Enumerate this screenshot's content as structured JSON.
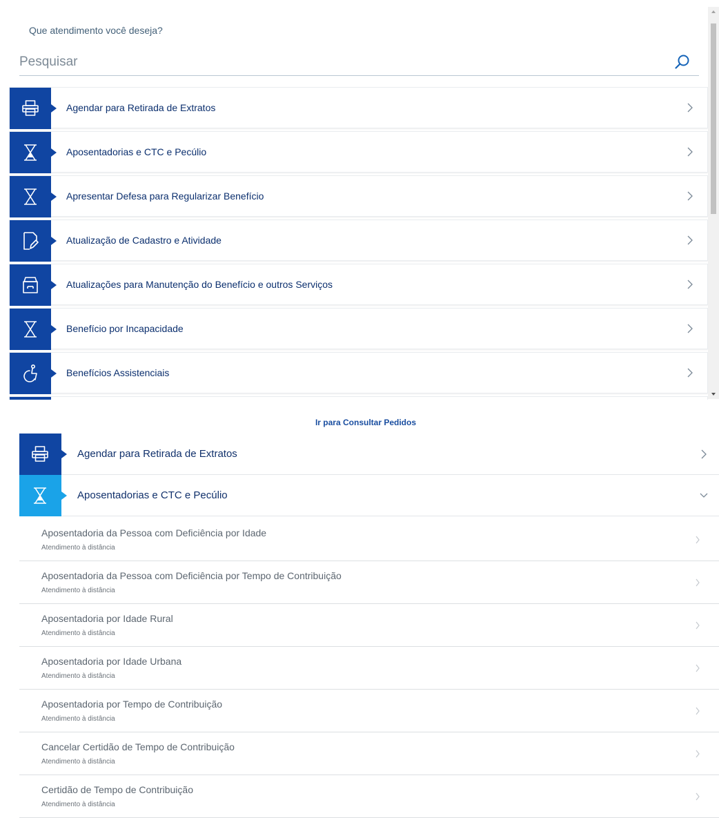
{
  "search": {
    "prompt": "Que atendimento você deseja?",
    "placeholder": "Pesquisar"
  },
  "categories": [
    {
      "label": "Agendar para Retirada de Extratos",
      "icon": "printer-icon"
    },
    {
      "label": "Aposentadorias e CTC e Pecúlio",
      "icon": "hourglass-icon"
    },
    {
      "label": "Apresentar Defesa para Regularizar Benefício",
      "icon": "hourglass-icon"
    },
    {
      "label": "Atualização de Cadastro e Atividade",
      "icon": "document-edit-icon"
    },
    {
      "label": "Atualizações para Manutenção do Benefício e outros Serviços",
      "icon": "archive-box-icon"
    },
    {
      "label": "Benefício por Incapacidade",
      "icon": "hourglass-icon"
    },
    {
      "label": "Benefícios Assistenciais",
      "icon": "accessibility-icon"
    },
    {
      "label": "",
      "icon": "category-icon"
    }
  ],
  "consult_link": "Ir para Consultar Pedidos",
  "accordion": {
    "items": [
      {
        "label": "Agendar para Retirada de Extratos",
        "icon": "printer-icon",
        "expanded": false
      },
      {
        "label": "Aposentadorias e CTC e Pecúlio",
        "icon": "hourglass-icon",
        "expanded": true
      }
    ],
    "subitems": [
      {
        "title": "Aposentadoria da Pessoa com Deficiência por Idade",
        "note": "Atendimento à distância"
      },
      {
        "title": "Aposentadoria da Pessoa com Deficiência por Tempo de Contribuição",
        "note": "Atendimento à distância"
      },
      {
        "title": "Aposentadoria por Idade Rural",
        "note": "Atendimento à distância"
      },
      {
        "title": "Aposentadoria por Idade Urbana",
        "note": "Atendimento à distância"
      },
      {
        "title": "Aposentadoria por Tempo de Contribuição",
        "note": "Atendimento à distância"
      },
      {
        "title": "Cancelar Certidão de Tempo de Contribuição",
        "note": "Atendimento à distância"
      },
      {
        "title": "Certidão de Tempo de Contribuição",
        "note": "Atendimento à distância"
      }
    ]
  },
  "colors": {
    "tile": "#1045a2",
    "tile_active": "#1aa3e8",
    "label": "#0b2f6e",
    "link": "#1a4ea0"
  }
}
